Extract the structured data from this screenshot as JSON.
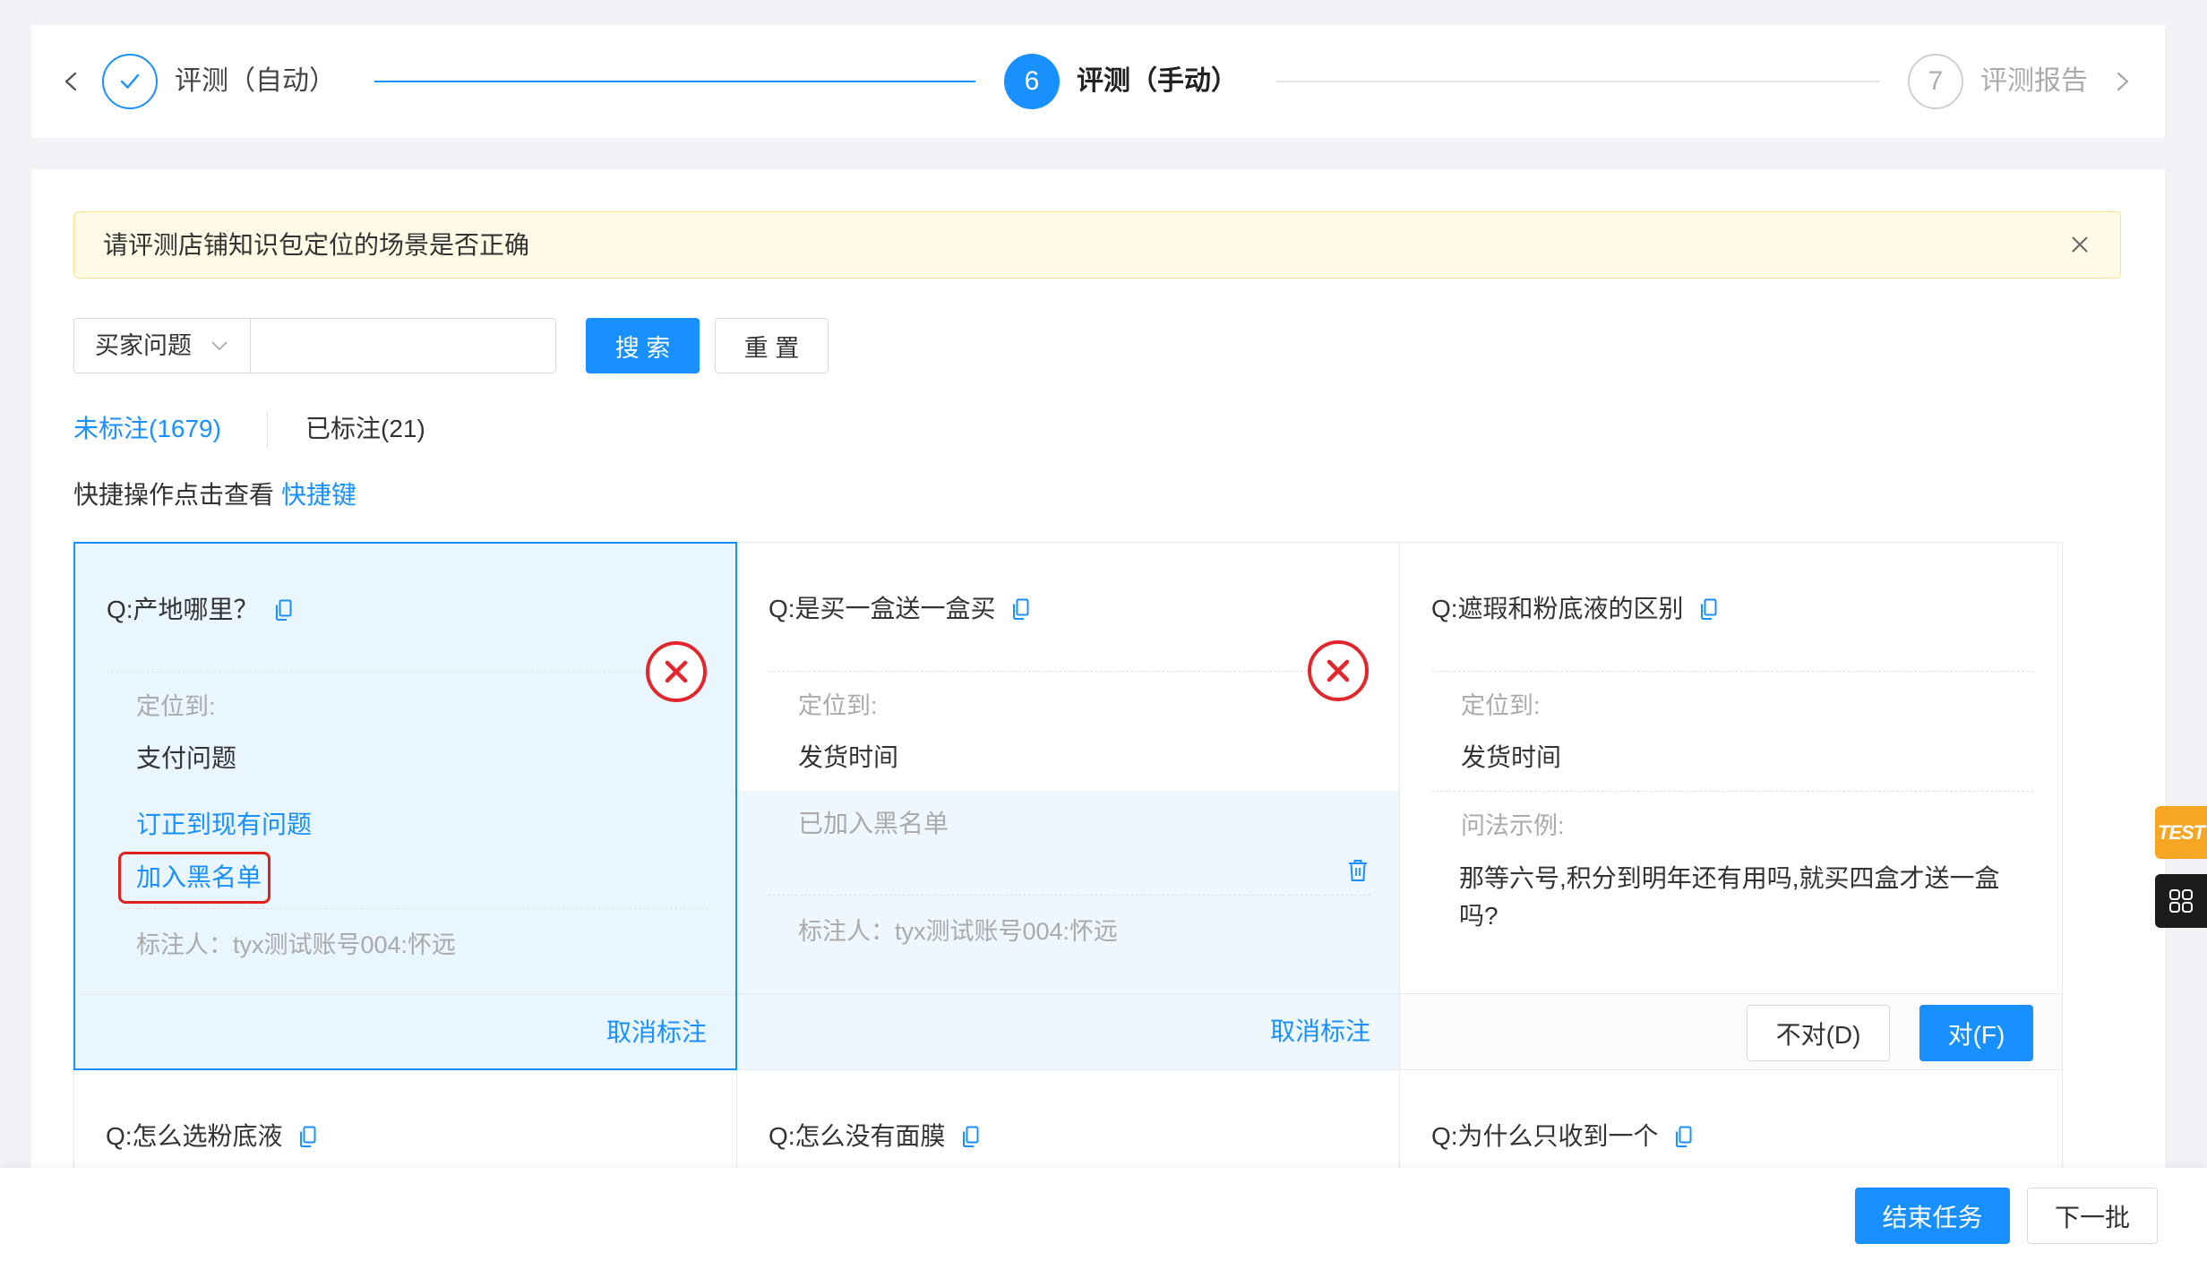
{
  "colors": {
    "primary": "#1890ff",
    "danger": "#e3262c",
    "badge": "#f6a623"
  },
  "steps": {
    "back_icon": "chevron-left-icon",
    "forward_icon": "chevron-right-icon",
    "items": [
      {
        "label": "评测（自动）",
        "completed": true,
        "icon": "check-icon"
      },
      {
        "number": "6",
        "label": "评测（手动）",
        "current": true
      },
      {
        "number": "7",
        "label": "评测报告"
      }
    ]
  },
  "alert": {
    "text": "请评测店铺知识包定位的场景是否正确",
    "close_icon": "close-icon"
  },
  "search": {
    "field": "买家问题",
    "input_value": "",
    "search_label": "搜 索",
    "reset_label": "重 置"
  },
  "tabs": [
    {
      "label": "未标注(1679)",
      "active": true
    },
    {
      "label": "已标注(21)",
      "active": false
    }
  ],
  "shortcut": {
    "text": "快捷操作点击查看",
    "link": "快捷键"
  },
  "cards": [
    {
      "question": "Q:产地哪里？",
      "located_label": "定位到:",
      "located_value": "支付问题",
      "correct_link": "订正到现有问题",
      "blacklist_link": "加入黑名单",
      "annotator": "标注人：tyx测试账号004:怀远",
      "cancel": "取消标注",
      "marked_wrong": true,
      "selected": true
    },
    {
      "question": "Q:是买一盒送一盒买",
      "located_label": "定位到:",
      "located_value": "发货时间",
      "blacklist_status": "已加入黑名单",
      "annotator": "标注人：tyx测试账号004:怀远",
      "cancel": "取消标注",
      "marked_wrong": true
    },
    {
      "question": "Q:遮瑕和粉底液的区别",
      "located_label": "定位到:",
      "located_value": "发货时间",
      "example_label": "问法示例:",
      "example_text": "那等六号,积分到明年还有用吗,就买四盒才送一盒吗?",
      "wrong_button": "不对(D)",
      "right_button": "对(F)"
    },
    {
      "question": "Q:怎么选粉底液"
    },
    {
      "question": "Q:怎么没有面膜"
    },
    {
      "question": "Q:为什么只收到一个"
    }
  ],
  "footer": {
    "end_task": "结束任务",
    "next_batch": "下一批"
  },
  "side": {
    "badge": "TEST",
    "apps_icon": "apps-grid-icon"
  }
}
